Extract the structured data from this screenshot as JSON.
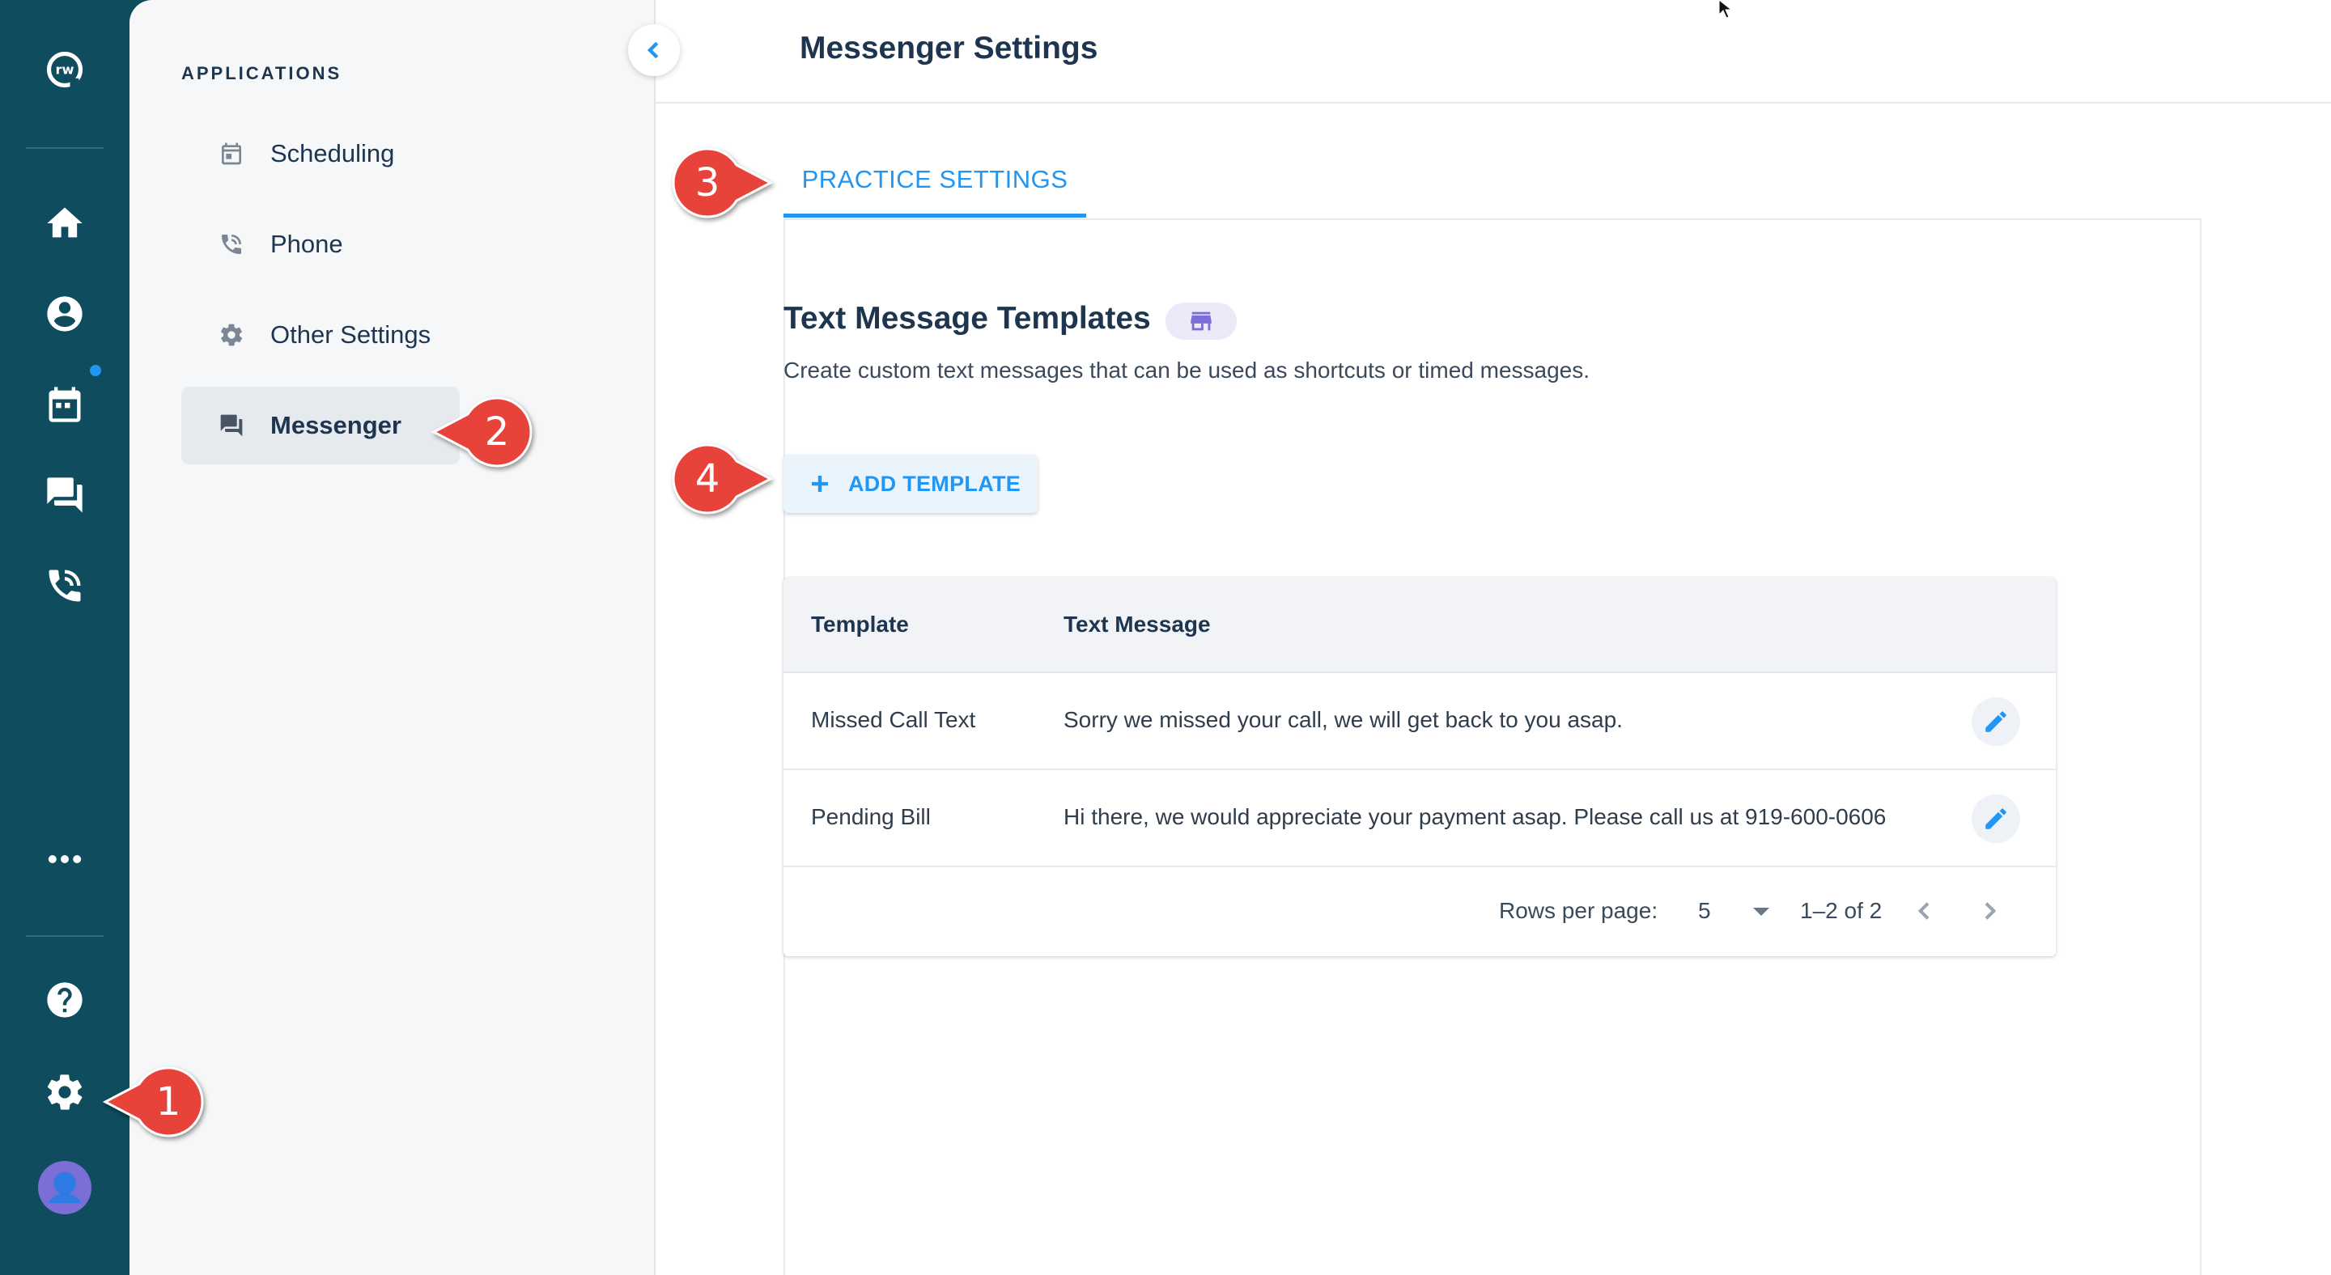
{
  "colors": {
    "rail": "#0e4c5e",
    "accent": "#2196f3",
    "callout": "#e8433a"
  },
  "rail": {
    "icons": [
      "logo-icon",
      "home-icon",
      "person-icon",
      "calendar-icon",
      "chat-icon",
      "phone-icon",
      "more-icon",
      "help-icon",
      "settings-icon",
      "avatar"
    ]
  },
  "sidebar": {
    "section_label": "APPLICATIONS",
    "items": [
      {
        "label": "Scheduling",
        "icon": "calendar-icon"
      },
      {
        "label": "Phone",
        "icon": "phone-icon"
      },
      {
        "label": "Other Settings",
        "icon": "gear-icon"
      },
      {
        "label": "Messenger",
        "icon": "chat-icon",
        "active": true
      }
    ]
  },
  "header": {
    "title": "Messenger Settings"
  },
  "tabs": [
    {
      "label": "PRACTICE SETTINGS",
      "active": true
    }
  ],
  "templates": {
    "title": "Text Message Templates",
    "description": "Create custom text messages that can be used as shortcuts or timed messages.",
    "add_label": "ADD TEMPLATE",
    "columns": [
      "Template",
      "Text Message"
    ],
    "rows": [
      {
        "template": "Missed Call Text",
        "message": "Sorry we missed your call, we will get back to you asap."
      },
      {
        "template": "Pending Bill",
        "message": "Hi there, we would appreciate your payment asap. Please call us at 919-600-0606"
      }
    ],
    "pagination": {
      "rows_per_page_label": "Rows per page:",
      "rows_per_page": "5",
      "range": "1–2 of 2"
    }
  },
  "callouts": [
    "1",
    "2",
    "3",
    "4"
  ]
}
